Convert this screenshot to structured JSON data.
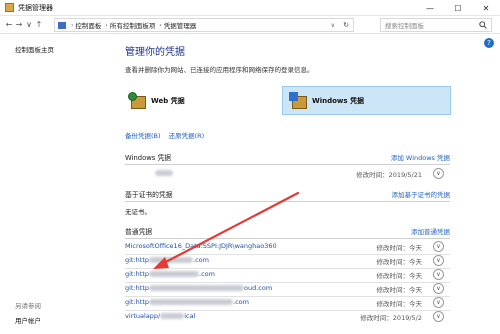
{
  "window": {
    "title": "凭据管理器",
    "controls": {
      "minimize": "—",
      "maximize": "☐",
      "close": "✕"
    }
  },
  "address": {
    "nav": {
      "back": "←",
      "forward": "→",
      "dropdown": "∨",
      "up": "↑"
    },
    "breadcrumbs": [
      "控制面板",
      "所有控制面板项",
      "凭据管理器"
    ],
    "separator": "›",
    "dropdown": "∨",
    "refresh": "↻"
  },
  "search": {
    "placeholder": "搜索控制面板",
    "icon": "search-icon"
  },
  "sidebar": {
    "home_link": "控制面板主页",
    "see_also_label": "另请参阅",
    "user_accounts_link": "用户帐户"
  },
  "help": {
    "label": "?"
  },
  "main": {
    "title": "管理你的凭据",
    "subtitle": "查看并删除你为网站、已连接的应用程序和网络保存的登录信息。",
    "tiles": [
      {
        "label": "Web 凭据",
        "selected": false
      },
      {
        "label": "Windows 凭据",
        "selected": true
      }
    ],
    "backup_link": "备份凭据(B)",
    "restore_link": "还原凭据(R)"
  },
  "sections": {
    "windows": {
      "title": "Windows 凭据",
      "action": "添加 Windows 凭据",
      "rows": [
        {
          "name": "",
          "modified": "修改时间：2019/5/21"
        }
      ]
    },
    "certificate": {
      "title": "基于证书的凭据",
      "action": "添加基于证书的凭据",
      "empty_text": "无证书。"
    },
    "generic": {
      "title": "普通凭据",
      "action": "添加普通凭据",
      "rows": [
        {
          "name": "MicrosoftOffice16_Data:SSPI:JDJR\\wanghao360",
          "modified": "修改时间：今天"
        },
        {
          "name_prefix": "git:http",
          "name_suffix": ".com",
          "modified": "修改时间：今天"
        },
        {
          "name_prefix": "git:http",
          "name_suffix": ".com",
          "modified": "修改时间：今天"
        },
        {
          "name_prefix": "git:http",
          "name_suffix": "oud.com",
          "modified": "修改时间：今天"
        },
        {
          "name_prefix": "git:http",
          "name_suffix": ".com",
          "modified": "修改时间：今天"
        },
        {
          "name_prefix": "virtualapp/",
          "name_suffix": "ical",
          "modified": "修改时间：2019/5/2"
        }
      ]
    }
  },
  "expand_glyph": "∨",
  "accent": "#1f5fbf",
  "annotation_color": "#e53935"
}
